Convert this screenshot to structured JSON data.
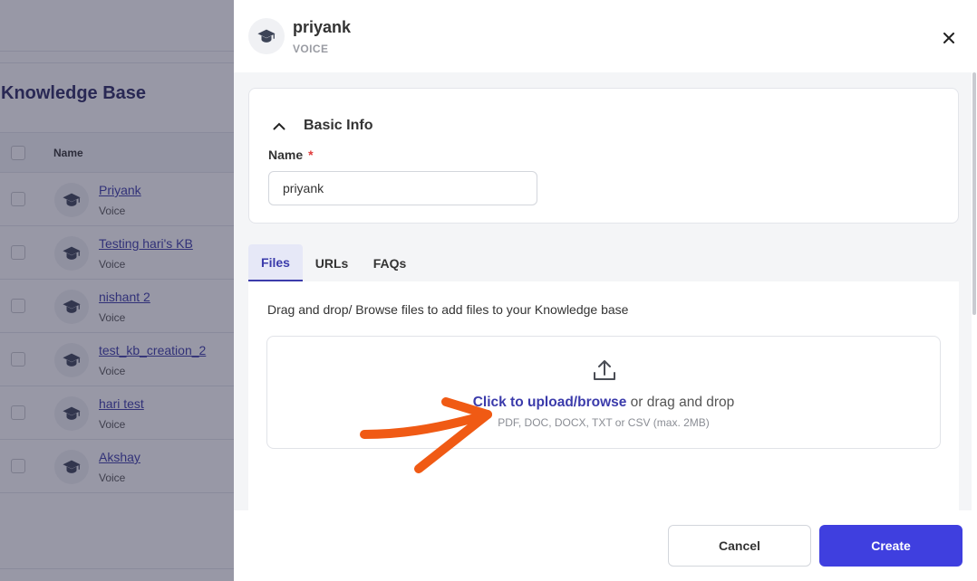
{
  "background": {
    "page_title": "Knowledge Base",
    "table": {
      "column_name": "Name",
      "rows": [
        {
          "name": "Priyank",
          "type": "Voice"
        },
        {
          "name": "Testing hari's KB",
          "type": "Voice"
        },
        {
          "name": "nishant 2",
          "type": "Voice"
        },
        {
          "name": "test_kb_creation_2",
          "type": "Voice"
        },
        {
          "name": "hari test",
          "type": "Voice"
        },
        {
          "name": "Akshay",
          "type": "Voice"
        }
      ]
    }
  },
  "drawer": {
    "title": "priyank",
    "subtitle": "VOICE",
    "icon": "graduation-cap-icon",
    "close_icon": "close-icon",
    "basic_info": {
      "section_title": "Basic Info",
      "name_label": "Name",
      "required_marker": "*",
      "name_value": "priyank"
    },
    "tabs": [
      {
        "label": "Files",
        "active": true
      },
      {
        "label": "URLs",
        "active": false
      },
      {
        "label": "FAQs",
        "active": false
      }
    ],
    "files_panel": {
      "description": "Drag and drop/ Browse files to add files to your Knowledge base",
      "upload_icon": "upload-icon",
      "upload_link": "Click to upload/browse",
      "upload_suffix": " or drag and drop",
      "upload_hint": "PDF, DOC, DOCX, TXT or CSV (max. 2MB)"
    },
    "footer": {
      "cancel_label": "Cancel",
      "create_label": "Create"
    }
  },
  "colors": {
    "accent": "#3f3fdf",
    "link": "#3b3bab",
    "annotation_arrow": "#f05a14",
    "required": "#e03b3b"
  }
}
